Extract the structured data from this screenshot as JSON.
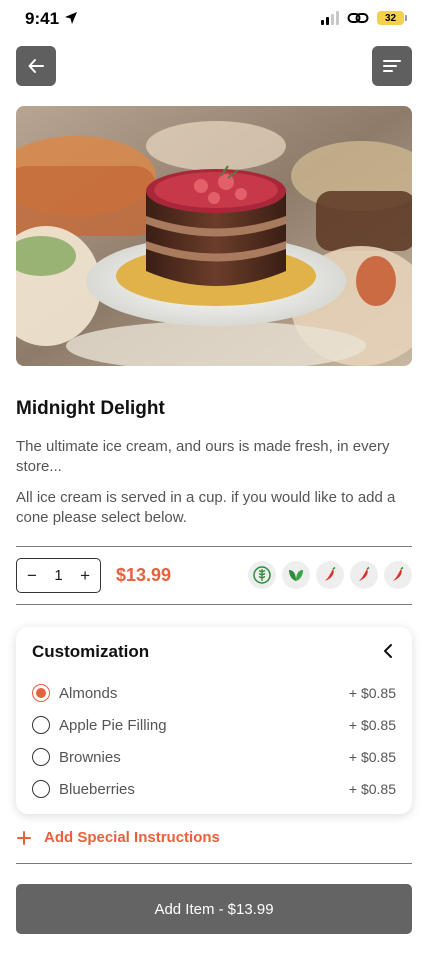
{
  "status_bar": {
    "time": "9:41",
    "battery": "32"
  },
  "product": {
    "name": "Midnight Delight",
    "description": "The ultimate ice cream, and ours is made fresh, in every store...",
    "note": "All ice cream is served in a cup. if you would like to add a cone please select below.",
    "quantity": "1",
    "price": "$13.99"
  },
  "icons": {
    "back": "arrow-left-icon",
    "menu": "menu-lines-icon",
    "tags": [
      "gluten-free-icon",
      "vegan-leaf-icon",
      "chili-pepper-icon",
      "chili-pepper-icon",
      "chili-pepper-icon"
    ]
  },
  "customization": {
    "title": "Customization",
    "options": [
      {
        "name": "Almonds",
        "price": "+ $0.85",
        "selected": true
      },
      {
        "name": "Apple Pie Filling",
        "price": "+ $0.85",
        "selected": false
      },
      {
        "name": "Brownies",
        "price": "+ $0.85",
        "selected": false
      },
      {
        "name": "Blueberries",
        "price": "+ $0.85",
        "selected": false
      }
    ]
  },
  "special_instructions": {
    "label": "Add Special Instructions"
  },
  "add_button": {
    "label": "Add Item -",
    "price": "$13.99"
  },
  "colors": {
    "accent": "#e8613f",
    "button": "#646464",
    "nav_button": "#5f5f5f"
  }
}
